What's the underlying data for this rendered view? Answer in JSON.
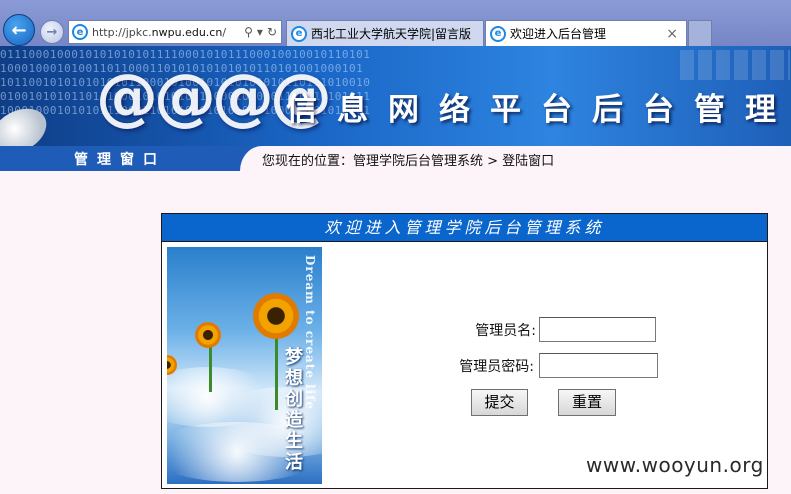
{
  "browser": {
    "address_url_prefix": "http://jpkc.",
    "address_url_host": "nwpu.edu.cn",
    "address_url_suffix": "/",
    "tabs": [
      {
        "label": "西北工业大学航天学院|留言版",
        "active": false
      },
      {
        "label": "欢迎进入后台管理",
        "active": true
      }
    ],
    "close_glyph": "×",
    "search_glyph": "⚲",
    "dropdown_glyph": "▾",
    "refresh_glyph": "↻",
    "back_glyph": "←",
    "forward_glyph": "→",
    "ie_glyph": "e"
  },
  "banner": {
    "at_symbols": "@@@@",
    "title": "信息网络平台后台管理",
    "window_label": "管理窗口",
    "breadcrumb": "您现在的位置：管理学院后台管理系统 > 登陆窗口"
  },
  "login": {
    "header": "欢迎进入管理学院后台管理系统",
    "side_image_en": "Dream to create life",
    "side_image_cn": "梦想创造生活",
    "username_label": "管理员名:",
    "username_value": "",
    "password_label": "管理员密码:",
    "password_value": "",
    "submit_label": "提交",
    "reset_label": "重置"
  },
  "watermark": "www.wooyun.org"
}
